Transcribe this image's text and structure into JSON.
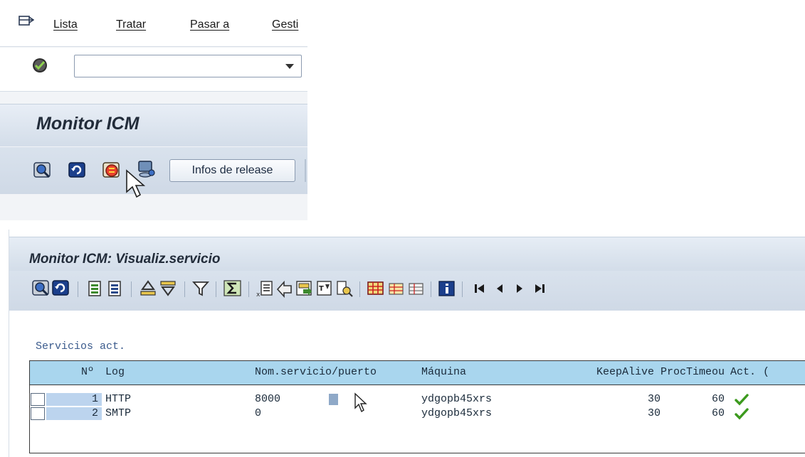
{
  "menubar": {
    "items": [
      "Lista",
      "Tratar",
      "Pasar a",
      "Gesti"
    ]
  },
  "command_field": {
    "value": ""
  },
  "top_panel": {
    "title": "Monitor ICM",
    "release_button_label": "Infos de release"
  },
  "bottom_panel": {
    "title": "Monitor ICM: Visualiz.servicio",
    "list_title": "Servicios act.",
    "columns": [
      "Nº",
      "Log",
      "Nom.servicio/puerto",
      "Máquina",
      "KeepAlive",
      "ProcTimeou",
      "Act.",
      "("
    ],
    "rows": [
      {
        "no": "1",
        "log": "HTTP",
        "port": "8000",
        "host": "ydgopb45xrs",
        "keepalive": "30",
        "proctimeout": "60",
        "active": true
      },
      {
        "no": "2",
        "log": "SMTP",
        "port": "0",
        "host": "ydgopb45xrs",
        "keepalive": "30",
        "proctimeout": "60",
        "active": true
      }
    ]
  },
  "colors": {
    "title_text": "#222c3a",
    "header_row_bg": "#a9d6ee",
    "key_cell_bg": "#bcd4ee",
    "check_green": "#3c9a1e",
    "list_title_text": "#3a5a8c"
  },
  "icons": {
    "menu": "menu-icon",
    "enter": "enter-check-icon",
    "dropdown": "chevron-down-icon",
    "toolbar_top": [
      "display-icon",
      "refresh-icon",
      "services-icon",
      "monitor-icon"
    ],
    "toolbar_bottom": [
      "detail-icon",
      "refresh-icon",
      "select-all-icon",
      "deselect-all-icon",
      "sort-asc-icon",
      "sort-desc-icon",
      "filter-icon",
      "sum-icon",
      "export-icon",
      "send-icon",
      "save-icon",
      "abc-icon",
      "find-icon",
      "layout-icon",
      "layout-change-icon",
      "layout-save-icon",
      "info-icon",
      "first-page-icon",
      "prev-page-icon",
      "next-page-icon",
      "last-page-icon"
    ]
  }
}
